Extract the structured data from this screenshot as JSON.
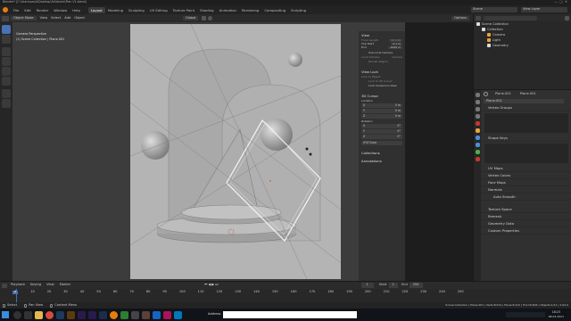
{
  "window": {
    "title": "Blender* [C:\\Users\\sanjit\\Desktop\\3d\\Ishant\\Plan V1.blend]"
  },
  "menu": [
    "File",
    "Edit",
    "Render",
    "Window",
    "Help"
  ],
  "workspaces": [
    "Layout",
    "Modeling",
    "Sculpting",
    "UV Editing",
    "Texture Paint",
    "Shading",
    "Animation",
    "Rendering",
    "Compositing",
    "Scripting"
  ],
  "active_workspace": "Layout",
  "scene": {
    "name": "Scene",
    "view_layer": "View Layer"
  },
  "header": {
    "mode": "Object Mode",
    "view": "View",
    "select": "Select",
    "add": "Add",
    "object": "Object",
    "orientation": "Global",
    "options": "Options"
  },
  "viewport": {
    "mode_info": "Camera Perspective",
    "collection_info": "(1) Scene Collection | Plane.001"
  },
  "npanel": {
    "view": {
      "title": "View",
      "focal_length_label": "Focal Length",
      "focal_length": "50 mm",
      "clip_start_label": "Clip Start",
      "clip_start": "0.1 m",
      "end_label": "End",
      "end": "1000 m",
      "use_local_camera": "Use Local Camera",
      "local_camera_label": "Local Camera",
      "local_camera": "Camera",
      "render_region": "Render Region"
    },
    "view_lock": {
      "title": "View Lock",
      "lock_to_object": "Lock to Object",
      "lock_3d_cursor": "Lock to 3D Cursor",
      "lock_camera": "Lock Camera to View"
    },
    "cursor": {
      "title": "3D Cursor",
      "location": "Location",
      "x": "0 m",
      "y": "0 m",
      "z": "0 m",
      "rotation": "Rotation",
      "rx": "0°",
      "ry": "0°",
      "rz": "0°",
      "mode": "XYZ Euler"
    },
    "collections": "Collections",
    "annotations": "Annotations"
  },
  "outliner": {
    "root": "Scene Collection",
    "items": [
      "Collection",
      "Camera",
      "Light",
      "Geometry"
    ]
  },
  "properties": {
    "object_name": "Plane.001",
    "data_name": "Plane.001",
    "mesh_name": "Plane.001",
    "sections": [
      "Vertex Groups",
      "Shape Keys",
      "UV Maps",
      "Vertex Colors",
      "Face Maps",
      "Normals",
      "Auto Smooth",
      "Texture Space",
      "Remesh",
      "Geometry Data",
      "Custom Properties"
    ]
  },
  "timeline": {
    "menus": [
      "Playback",
      "Keying",
      "View",
      "Marker"
    ],
    "frame": "1",
    "start_label": "Start",
    "start": "1",
    "end_label": "End",
    "end": "250",
    "ticks": [
      "0",
      "10",
      "20",
      "30",
      "40",
      "50",
      "60",
      "70",
      "80",
      "90",
      "100",
      "110",
      "120",
      "130",
      "140",
      "150",
      "160",
      "170",
      "180",
      "190",
      "200",
      "210",
      "220",
      "230",
      "240",
      "250"
    ]
  },
  "statusbar": {
    "items": [
      "Select",
      "Pan View",
      "Context Menu"
    ],
    "stats": "Scene Collection | Plane.001 | Verts:8,514 | Faces:8,412 | Tris:16,824 | Objects:1/11 | 2.92.0"
  },
  "taskbar": {
    "address_label": "Address",
    "time": "18:23",
    "date": "08-03-2021"
  },
  "colors": {
    "viewport_bg": "#b4b4b4",
    "accent": "#4772b3",
    "panel": "#303030",
    "header": "#2b2b2b"
  }
}
